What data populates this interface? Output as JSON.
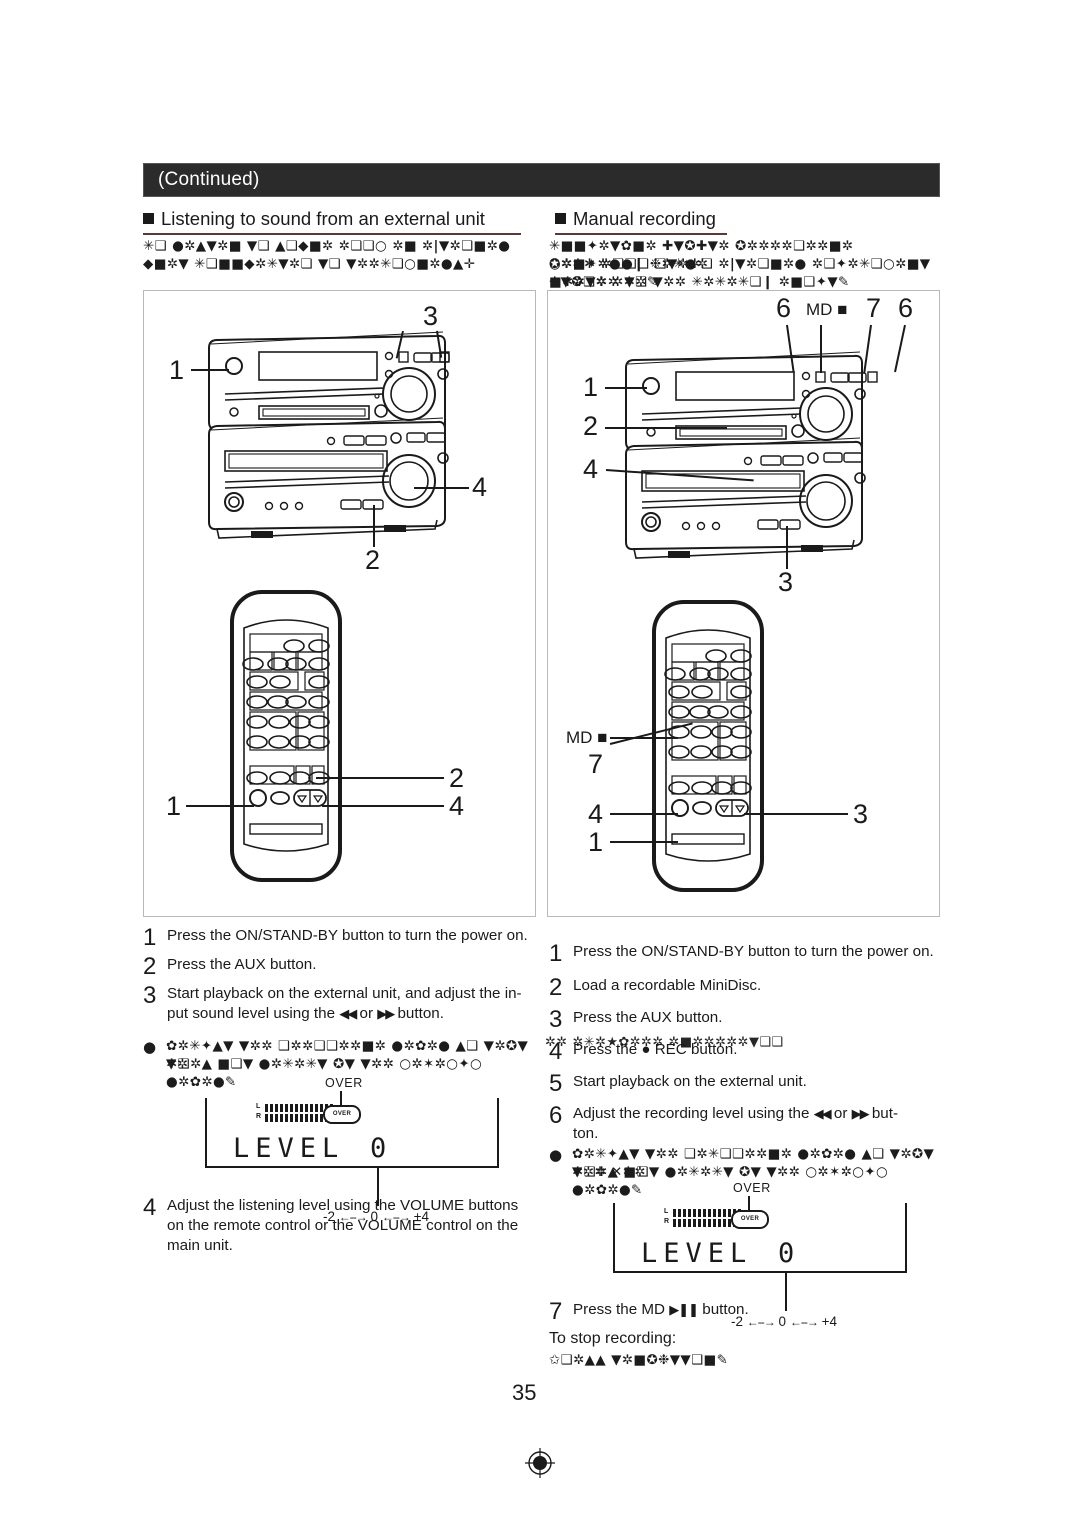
{
  "header": {
    "continued_label": "(Continued)"
  },
  "sections": {
    "left": {
      "heading": "Listening to sound from an external unit",
      "intro_symbols": "✳❑ ●✲▲▼✲■ ▼❑ ▲❑◆■✲ ✲❑❑○ ✲■ ✲|▼✲❑■✲● ◆■✲▼ ✳❑■■◆✲✳▼✲❑ ▼❑ ▼✲✲✳❑○■✲●▲✛",
      "steps": [
        {
          "n": "1",
          "text": "Press the ON/STAND-BY button to turn the power on."
        },
        {
          "n": "2",
          "text": "Press the AUX button."
        },
        {
          "n": "3",
          "text": "Start playback on the external unit, and adjust the in-put sound level using the ◀◀ or ▶▶ button."
        },
        {
          "n": "4",
          "text": "Adjust the listening level using the VOLUME buttons on the remote control or the VOLUME control on the main unit."
        }
      ],
      "step3_line1": "Start playback on the external unit, and adjust the in-",
      "step3_line2a": "put sound level using the",
      "step3_arrow_left": "◀◀",
      "step3_or": "or",
      "step3_arrow_right": "▶▶",
      "step3_line2b": "button.",
      "step4_line1": "Adjust the listening level using the VOLUME buttons",
      "step4_line2": "on the remote control or the VOLUME control on the",
      "step4_line3": "main unit.",
      "note_bullet": "●",
      "note_symbols_line1": "✿✲✳✦▲▼ ▼✲✲ ❑✲✲❑❑✲✲■✲ ●✲✿✲● ▲❑ ▼✲✪▼ ▼✲",
      "note_symbols_line2": "✲❑✲▲ ■❑▼ ●✲✳✲✳▼ ✪▼ ▼✲✲ ○✲✶✲○✦○ ●✲✿✲●✎",
      "callouts": [
        "1",
        "2",
        "3",
        "4"
      ],
      "remote_callouts": [
        "1",
        "2",
        "4"
      ]
    },
    "right": {
      "heading": "Manual recording",
      "intro_symbols_line1": "✳■■✦✲▼✿■✲ ✚▼✪✚▼✲ ✪✲✲✲✲❑✲✲■✲ ○✲■✦✲●●❙ ❉✲✳●✲",
      "intro_symbols_line2": "✪✲✲✲ ✲❑❑❑ ❑▼✲✲❑ ✲|▼✲❑■✲● ✲❑✦✲✳❑○✲■▼ ✛▼✪❑✲ ✲✲✲✎",
      "intro_symbols_line3": "■✲✲▼✲✲ ▼❑ ▼✲✲ ✳✲✳✲✳❑❙ ✲■❑✦▼✎",
      "steps": [
        {
          "n": "1",
          "text": "Press the ON/STAND-BY button to turn the power on."
        },
        {
          "n": "2",
          "text": "Load a recordable MiniDisc."
        },
        {
          "n": "3",
          "text": "Press the AUX button."
        },
        {
          "n": "4",
          "text": "Press the ● REC button."
        },
        {
          "n": "5",
          "text": "Start playback on the external unit."
        },
        {
          "n": "6",
          "text": "Adjust the  recording level using the ◀◀ or ▶▶ but-ton."
        },
        {
          "n": "7",
          "text": "Press the MD ▶❚❚ button."
        }
      ],
      "step4_overlay_symbols": "✲✲ ✲✳✲★✿✲✲✲ ✲■✲✲✲✲✲▼❑❑",
      "step4_prefix": "Press the",
      "step4_rec_dot": "●",
      "step4_suffix": "REC button.",
      "step6_line1a": "Adjust the  recording level using the",
      "step6_arrow_left": "◀◀",
      "step6_or": "or",
      "step6_arrow_right": "▶▶",
      "step6_line1b": "but-",
      "step6_line2": "ton.",
      "step7_prefix": "Press the MD",
      "step7_play_pause": "▶❚❚",
      "step7_suffix": "button.",
      "note_bullet": "●",
      "note_symbols_line1": "✿✲✳✦▲▼ ▼✲✲ ❑✲✳❑❑✲✲■✲ ●✲✿✲● ▲❑ ▼✲✪▼ ▼✲✲ ✕✲✲",
      "note_symbols_line2": "✲❑✲▲ ■❑▼ ●✲✳✲✳▼ ✪▼ ▼✲✲ ○✲✶✲○✦○ ●✲✿✲●✎",
      "stop_heading": "To stop recording:",
      "stop_symbols": "✩❑✲▲▲ ▼✲■✪❉▼▼❑■✎",
      "callouts": [
        "1",
        "2",
        "3",
        "4",
        "6",
        "7"
      ],
      "md_stop_label": "MD ■",
      "remote_callouts": [
        "1",
        "3",
        "4",
        "7"
      ],
      "remote_md_label": "MD ■"
    }
  },
  "lcd": {
    "over_label": "OVER",
    "over_pill_text": "OVER",
    "meter_left_label": "L",
    "meter_right_label": "R",
    "display_text": "LEVEL",
    "display_value": "0",
    "scale_min": "-2",
    "scale_mid": "0",
    "scale_max": "+4",
    "scale_arrow": "←--→"
  },
  "footer": {
    "page_number": "35"
  },
  "colors": {
    "ink": "#1a1a1a",
    "rule": "#5a3a36",
    "bar": "#2b2b2b",
    "frame": "#b9b9b9"
  }
}
